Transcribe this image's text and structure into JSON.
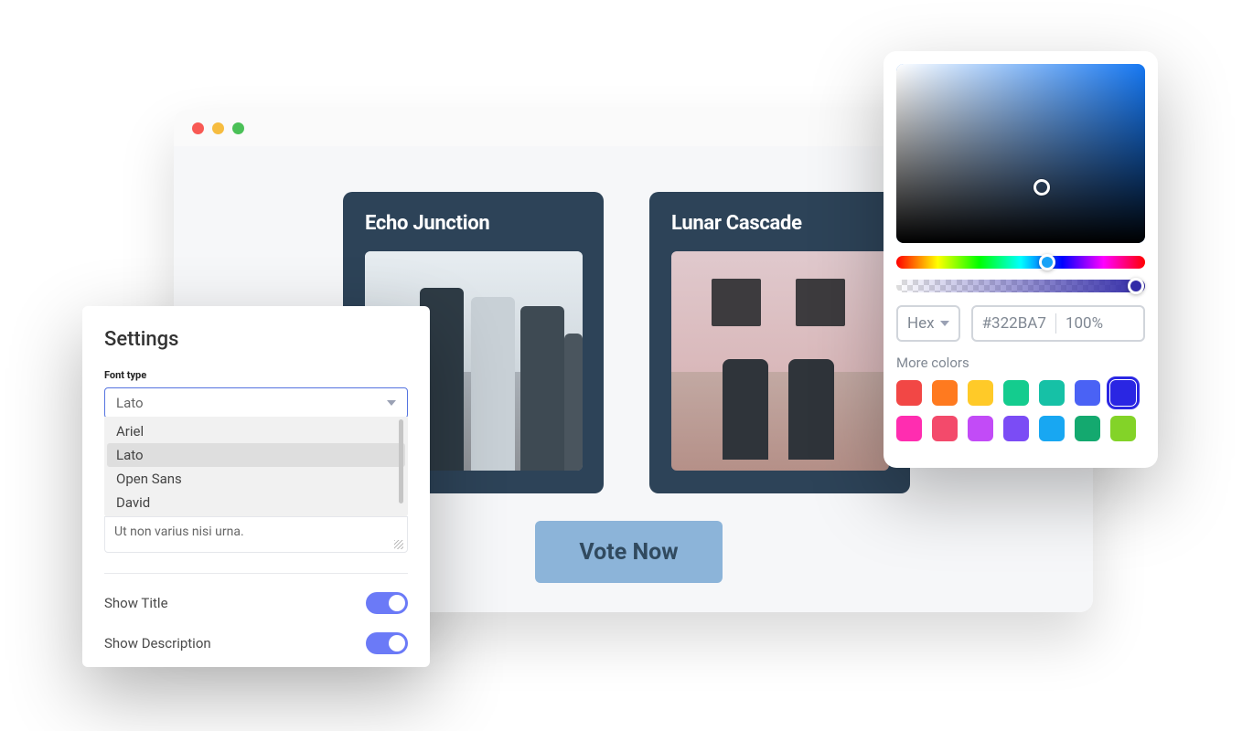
{
  "browser": {
    "traffic_lights": [
      "#f85954",
      "#f6bc3f",
      "#4ac057"
    ],
    "cards": [
      {
        "title": "Echo Junction"
      },
      {
        "title": "Lunar Cascade"
      }
    ],
    "vote_button": "Vote Now"
  },
  "settings": {
    "title": "Settings",
    "font_type": {
      "label": "Font type",
      "selected": "Lato",
      "options": [
        "Ariel",
        "Lato",
        "Open Sans",
        "David"
      ]
    },
    "placeholder_text": "Ut non varius nisi urna.",
    "toggles": {
      "show_title": {
        "label": "Show Title",
        "value": true
      },
      "show_description": {
        "label": "Show Description",
        "value": true
      }
    }
  },
  "color_picker": {
    "format": "Hex",
    "hex": "#322BA7",
    "opacity": "100%",
    "more_colors_label": "More colors",
    "swatches": [
      "#f24745",
      "#ff7a1f",
      "#ffca28",
      "#14cc8e",
      "#16c1a6",
      "#4a62f5",
      "#2a26e3",
      "#ff2db0",
      "#f34a6b",
      "#c24bf7",
      "#7b4cf5",
      "#18a7f2",
      "#14a96f",
      "#83d328"
    ],
    "selected_swatch_index": 6
  }
}
